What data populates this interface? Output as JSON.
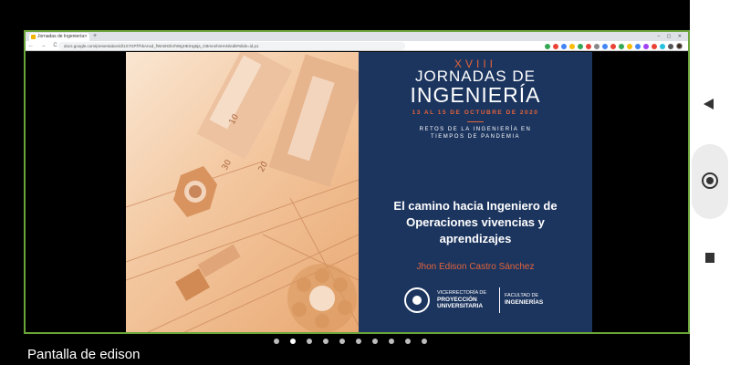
{
  "browser": {
    "tab_title": "Jornadas de Ingeniería",
    "new_tab_symbol": "+",
    "window_controls": "– ▢ ✕",
    "nav_buttons": "← → C",
    "url": "docs.google.com/presentation/d/1X7GPf7hkAnxd_fWm9GkVhWgHEiHg6ja_CBmnnhnHsN/edit#slide=id.p1",
    "extension_colors": [
      "#34a853",
      "#ea4335",
      "#4285f4",
      "#fbbc05",
      "#34a853",
      "#ea4335",
      "#888888",
      "#4285f4",
      "#ea4335",
      "#34a853",
      "#fbbc05",
      "#4285f4",
      "#a142f4",
      "#ea4335",
      "#24c1e0",
      "#555555"
    ]
  },
  "slide": {
    "edition": "XVIII",
    "event_title_line1": "JORNADAS DE",
    "event_title_line2": "INGENIERÍA",
    "dates": "13 AL 15 DE OCTUBRE DE 2020",
    "tagline_line1": "RETOS DE LA INGENIERÍA EN",
    "tagline_line2": "TIEMPOS DE PANDEMIA",
    "talk_title": "El camino hacia Ingeniero de Operaciones vivencias y aprendizajes",
    "speaker": "Jhon Edison Castro Sánchez",
    "vice_line1": "VICERRECTORÍA DE",
    "vice_line2": "PROYECCIÓN",
    "vice_line3": "UNIVERSITARIA",
    "faculty_line1": "FACULTAD DE",
    "faculty_line2": "INGENIERÍAS"
  },
  "caption": "Pantalla de edison",
  "pager": {
    "total": 10,
    "active_index": 1
  },
  "colors": {
    "accent": "#e2633a",
    "panel": "#1c355f",
    "frame": "#6aa53a"
  }
}
